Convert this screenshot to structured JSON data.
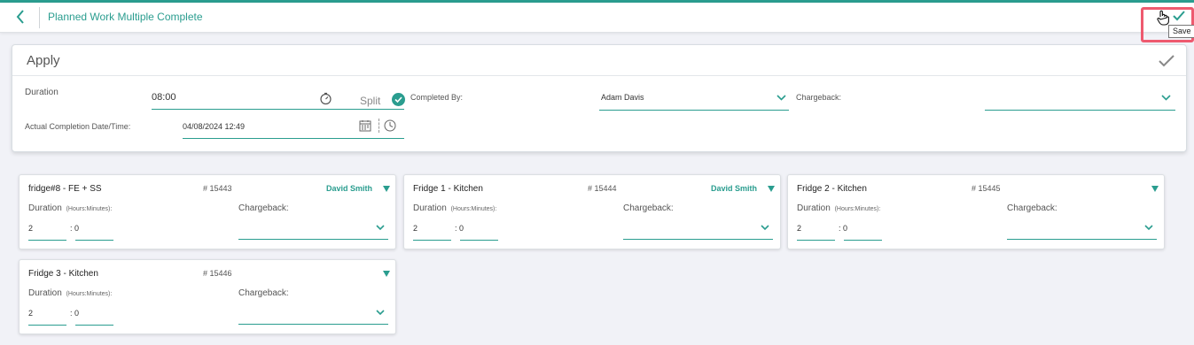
{
  "header": {
    "title": "Planned Work Multiple Complete",
    "save_tooltip": "Save",
    "accent_color": "#2a9d8f"
  },
  "apply": {
    "title": "Apply",
    "duration_label": "Duration",
    "duration_value": "08:00",
    "split_label": "Split",
    "completed_by_label": "Completed By:",
    "completed_by_value": "Adam Davis",
    "chargeback_label": "Chargeback:",
    "chargeback_value": "",
    "completion_label": "Actual Completion Date/Time:",
    "completion_value": "04/08/2024 12:49"
  },
  "work_orders": [
    {
      "name": "fridge#8 - FE + SS",
      "number": "# 15443",
      "assignee": "David Smith",
      "duration_label": "Duration",
      "duration_hint": "(Hours:Minutes):",
      "chargeback_label": "Chargeback:",
      "hours": "2",
      "minutes": "0"
    },
    {
      "name": "Fridge 1 - Kitchen",
      "number": "# 15444",
      "assignee": "David Smith",
      "duration_label": "Duration",
      "duration_hint": "(Hours:Minutes):",
      "chargeback_label": "Chargeback:",
      "hours": "2",
      "minutes": "0"
    },
    {
      "name": "Fridge 2 - Kitchen",
      "number": "# 15445",
      "assignee": "",
      "duration_label": "Duration",
      "duration_hint": "(Hours:Minutes):",
      "chargeback_label": "Chargeback:",
      "hours": "2",
      "minutes": "0"
    },
    {
      "name": "Fridge 3 - Kitchen",
      "number": "# 15446",
      "assignee": "",
      "duration_label": "Duration",
      "duration_hint": "(Hours:Minutes):",
      "chargeback_label": "Chargeback:",
      "hours": "2",
      "minutes": "0"
    }
  ],
  "icons": {
    "back": "chevron-left-icon",
    "save": "check-icon",
    "cursor": "hand-pointer-icon",
    "timer": "stopwatch-icon",
    "split": "check-circle-icon",
    "calendar": "calendar-icon",
    "clock": "clock-icon",
    "dropdown": "chevron-down-icon",
    "expand": "triangle-down-icon"
  }
}
